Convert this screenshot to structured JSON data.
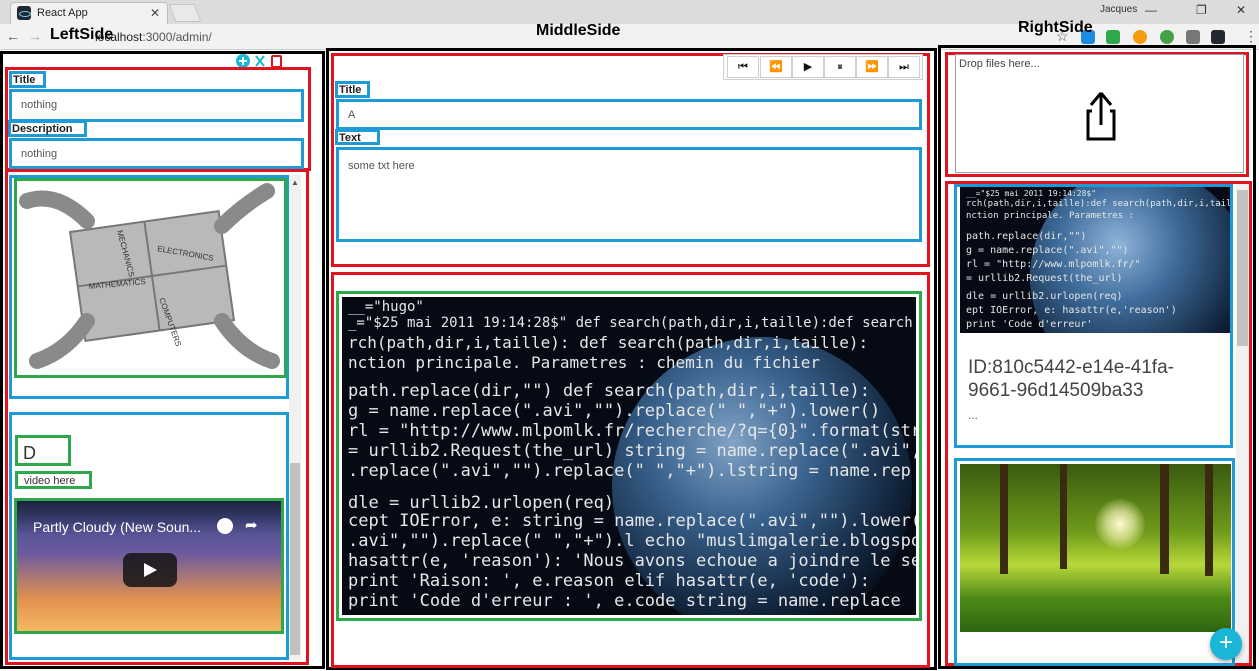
{
  "browser": {
    "tab_title": "React App",
    "tab_close": "✕",
    "user": "Jacques",
    "url_host": "localhost",
    "url_rest": ":3000/admin/",
    "window_controls": [
      "—",
      "❐",
      "✕"
    ]
  },
  "headings": {
    "left": "LeftSide",
    "middle": "MiddleSide",
    "right": "RightSide"
  },
  "left": {
    "toolbar_icons": [
      "add-icon",
      "close-icon",
      "delete-icon"
    ],
    "title_label": "Title",
    "title_value": "nothing",
    "description_label": "Description",
    "description_value": "nothing",
    "puzzle_words": [
      "MECHANICS",
      "ELECTRONICS",
      "MATHEMATICS",
      "COMPUTERS"
    ],
    "card_letter": "D",
    "video_label": "video here",
    "video_title": "Partly Cloudy (New Soun..."
  },
  "middle": {
    "controls": [
      "⏮",
      "⏪",
      "▶",
      "⏸",
      "⏩",
      "⏭"
    ],
    "title_label": "Title",
    "title_value": "A",
    "text_label": "Text",
    "text_value": "some txt here"
  },
  "right": {
    "drop_text": "Drop files here...",
    "card_id": "ID:810c5442-e14e-41fa-9661-96d14509ba33",
    "card_more": "...",
    "fab_label": "+"
  },
  "colors": {
    "red": "#e0141e",
    "blue": "#1e9ad6",
    "green": "#2ea84a",
    "fab": "#19b6d8"
  }
}
